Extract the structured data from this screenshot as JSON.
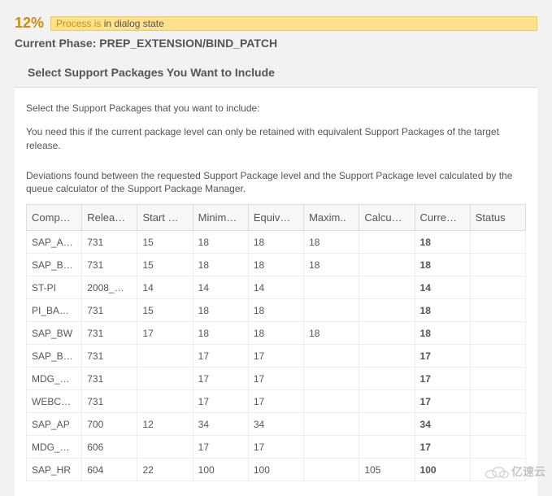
{
  "header": {
    "percent": "12%",
    "process_badge_prefix": "Process is ",
    "process_badge_suffix": "in dialog state",
    "phase_label": "Current Phase: ",
    "phase_value": "PREP_EXTENSION/BIND_PATCH"
  },
  "section": {
    "title": "Select Support Packages You Want to Include",
    "intro1": "Select the Support Packages that you want to include:",
    "intro2": "You need this if the current package level can only be retained with equivalent Support Packages of the target release.",
    "intro3": "Deviations found between the requested Support Package level and the Support Package level calculated by the queue calculator of the Support Package Manager."
  },
  "table": {
    "headers": [
      "Comp…",
      "Relea…",
      "Start …",
      "Minim…",
      "Equiv…",
      "Maxim..",
      "Calcu…",
      "Curre…",
      "Status"
    ],
    "rows": [
      {
        "cells": [
          "SAP_A…",
          "731",
          "15",
          "18",
          "18",
          "18",
          "",
          "18",
          ""
        ]
      },
      {
        "cells": [
          "SAP_B…",
          "731",
          "15",
          "18",
          "18",
          "18",
          "",
          "18",
          ""
        ]
      },
      {
        "cells": [
          "ST-PI",
          "2008_…",
          "14",
          "14",
          "14",
          "",
          "",
          "14",
          ""
        ]
      },
      {
        "cells": [
          "PI_BA…",
          "731",
          "15",
          "18",
          "18",
          "",
          "",
          "18",
          ""
        ]
      },
      {
        "cells": [
          "SAP_BW",
          "731",
          "17",
          "18",
          "18",
          "18",
          "",
          "18",
          ""
        ]
      },
      {
        "cells": [
          "SAP_B…",
          "731",
          "",
          "17",
          "17",
          "",
          "",
          "17",
          ""
        ]
      },
      {
        "cells": [
          "MDG_…",
          "731",
          "",
          "17",
          "17",
          "",
          "",
          "17",
          ""
        ]
      },
      {
        "cells": [
          "WEBC…",
          "731",
          "",
          "17",
          "17",
          "",
          "",
          "17",
          ""
        ]
      },
      {
        "cells": [
          "SAP_AP",
          "700",
          "12",
          "34",
          "34",
          "",
          "",
          "34",
          ""
        ]
      },
      {
        "cells": [
          "MDG_…",
          "606",
          "",
          "17",
          "17",
          "",
          "",
          "17",
          ""
        ]
      },
      {
        "cells": [
          "SAP_HR",
          "604",
          "22",
          "100",
          "100",
          "",
          "105",
          "100",
          ""
        ]
      }
    ]
  },
  "watermark": "亿速云"
}
